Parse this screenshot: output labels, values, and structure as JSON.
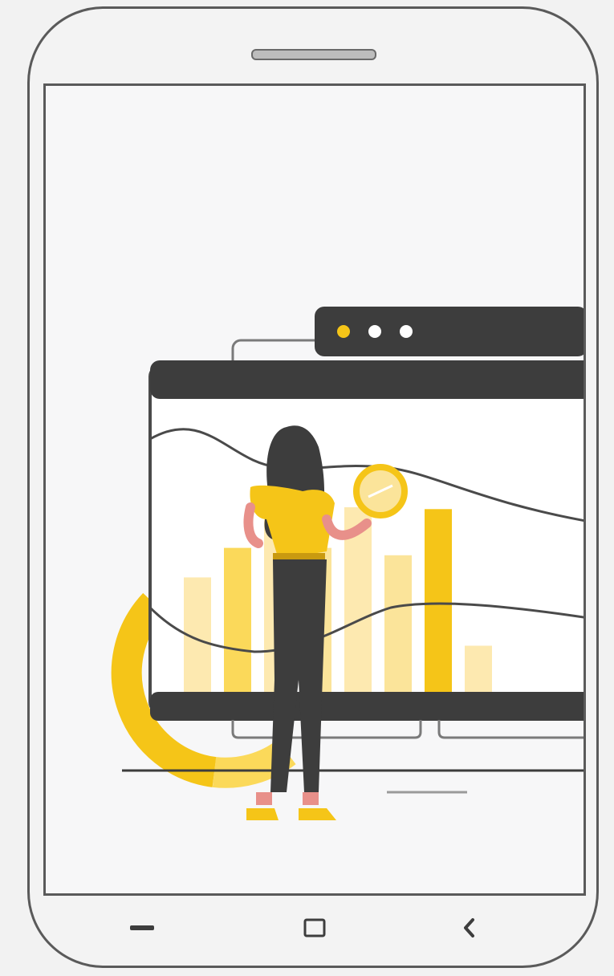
{
  "device": {
    "type": "android-phone",
    "colors": {
      "frame": "#5a5a5a",
      "screen": "#f7f7f8",
      "accent": "#f5c518",
      "accent_light": "#fbe49a",
      "dark": "#3d3d3d"
    }
  },
  "screen": {
    "illustration": "woman-analyzing-dashboard-illustration",
    "chart": {
      "bars": [
        0.62,
        0.78,
        0.97,
        0.78,
        1.0,
        0.74,
        0.99,
        0.25
      ]
    }
  },
  "navbar": {
    "items": [
      {
        "name": "recent-apps-icon"
      },
      {
        "name": "home-icon"
      },
      {
        "name": "back-icon"
      }
    ]
  }
}
